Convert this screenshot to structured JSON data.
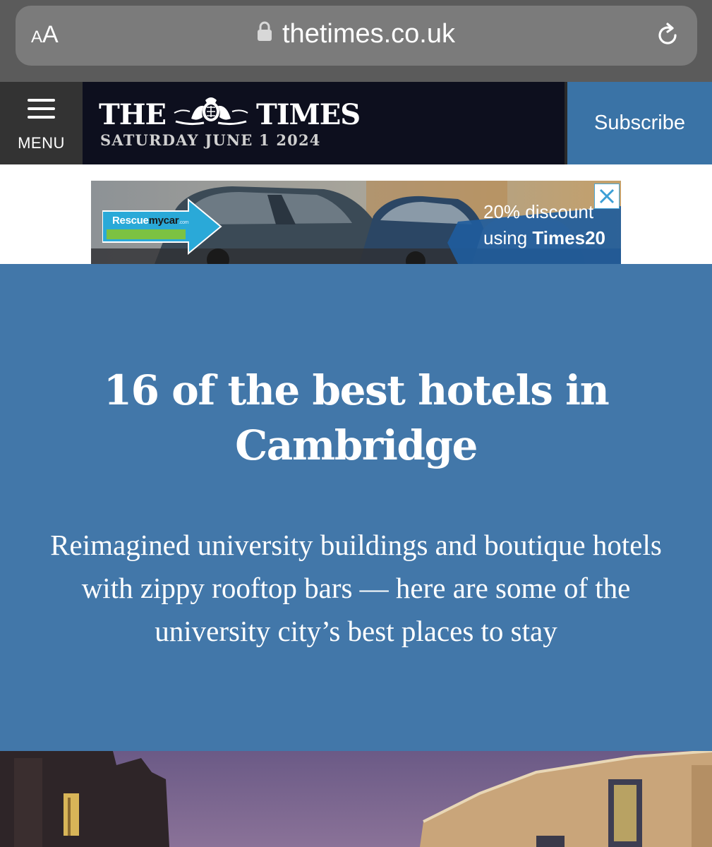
{
  "browser": {
    "text_size_small": "A",
    "text_size_large": "A",
    "url": "thetimes.co.uk"
  },
  "masthead": {
    "menu_label": "MENU",
    "logo_left": "THE",
    "logo_right": "TIMES",
    "date": "SATURDAY JUNE 1 2024",
    "subscribe_label": "Subscribe",
    "colors": {
      "masthead_bg": "#0d0f1e",
      "subscribe_bg": "#3a73a6"
    }
  },
  "advert": {
    "brand_part1": "Rescue",
    "brand_part2": "mycar",
    "brand_suffix": ".com",
    "offer_line1": "20% discount",
    "offer_line2_prefix": "using ",
    "offer_code": "Times20"
  },
  "article": {
    "title": "16 of the best hotels in Cambridge",
    "standfirst": "Reimagined university buildings and boutique hotels with zippy rooftop bars — here are some of the university city’s best places to stay",
    "hero_color": "#4277a9"
  }
}
